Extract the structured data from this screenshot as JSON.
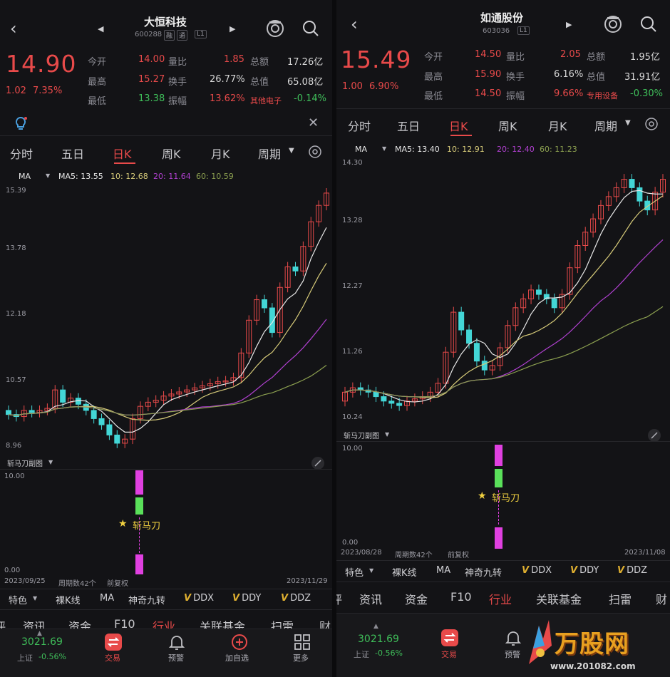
{
  "left": {
    "header": {
      "title": "大恒科技",
      "code": "600288",
      "tag1": "融",
      "tag2": "通",
      "tag3": "L1"
    },
    "price": {
      "last": "14.90",
      "change": "1.02",
      "pct": "7.35%"
    },
    "quote": {
      "r1": [
        "今开",
        "14.00",
        "量比",
        "1.85",
        "总额",
        "17.26亿"
      ],
      "r2": [
        "最高",
        "15.27",
        "换手",
        "26.77%",
        "总值",
        "65.08亿"
      ],
      "r3": [
        "最低",
        "13.38",
        "振幅",
        "13.62%",
        "其他电子",
        "-0.14%"
      ]
    },
    "tabs": [
      "分时",
      "五日",
      "日K",
      "周K",
      "月K",
      "周期"
    ],
    "ma": {
      "label": "MA",
      "ma5": "MA5: 13.55",
      "ma10": "10: 12.68",
      "ma20": "20: 11.64",
      "ma60": "60: 10.59"
    },
    "yaxis": [
      "15.39",
      "13.78",
      "12.18",
      "10.57",
      "8.96"
    ],
    "sub": {
      "name": "斩马刀副图",
      "top": "10.00",
      "bottom": "0.00",
      "signal": "斩马刀",
      "star": "★"
    },
    "dates": {
      "start": "2023/09/25",
      "period": "周期数42个",
      "adj": "前复权",
      "end": "2023/11/29"
    },
    "tools": [
      "特色",
      "裸K线",
      "MA",
      "神奇九转",
      "DDX",
      "DDY",
      "DDZ"
    ],
    "navtabs": [
      "评",
      "资讯",
      "资金",
      "F10",
      "行业",
      "关联基金",
      "扫雷",
      "财"
    ],
    "bottom": {
      "index": "3021.69",
      "index_label": "上证",
      "index_pct": "-0.56%",
      "trade": "交易",
      "alert": "预警",
      "add": "加自选",
      "more": "更多"
    }
  },
  "right": {
    "header": {
      "title": "如通股份",
      "code": "603036",
      "tag3": "L1"
    },
    "price": {
      "last": "15.49",
      "change": "1.00",
      "pct": "6.90%"
    },
    "quote": {
      "r1": [
        "今开",
        "14.50",
        "量比",
        "2.05",
        "总额",
        "1.95亿"
      ],
      "r2": [
        "最高",
        "15.90",
        "换手",
        "6.16%",
        "总值",
        "31.91亿"
      ],
      "r3": [
        "最低",
        "14.50",
        "振幅",
        "9.66%",
        "专用设备",
        "-0.30%"
      ]
    },
    "tabs": [
      "分时",
      "五日",
      "日K",
      "周K",
      "月K",
      "周期"
    ],
    "ma": {
      "label": "MA",
      "ma5": "MA5: 13.40",
      "ma10": "10: 12.91",
      "ma20": "20: 12.40",
      "ma60": "60: 11.23"
    },
    "yaxis": [
      "14.30",
      "13.28",
      "12.27",
      "11.26",
      "10.24"
    ],
    "sub": {
      "name": "斩马刀副图",
      "top": "10.00",
      "bottom": "0.00",
      "signal": "斩马刀",
      "star": "★"
    },
    "dates": {
      "start": "2023/08/28",
      "period": "周期数42个",
      "adj": "前复权",
      "end": "2023/11/08"
    },
    "tools": [
      "特色",
      "裸K线",
      "MA",
      "神奇九转",
      "DDX",
      "DDY",
      "DDZ"
    ],
    "navtabs": [
      "评",
      "资讯",
      "资金",
      "F10",
      "行业",
      "关联基金",
      "扫雷",
      "财"
    ],
    "bottom": {
      "index": "3021.69",
      "index_label": "上证",
      "index_pct": "-0.56%",
      "trade": "交易",
      "alert": "预警"
    }
  },
  "watermark": {
    "brand": "万股网",
    "url": "www.201082.com"
  },
  "colors": {
    "up": "#e84a4a",
    "down": "#43d6d6",
    "ma5": "#e8e8e8",
    "ma10": "#d8cc7a",
    "ma20": "#b040d0",
    "ma60": "#8ca050",
    "bg": "#131316"
  }
}
